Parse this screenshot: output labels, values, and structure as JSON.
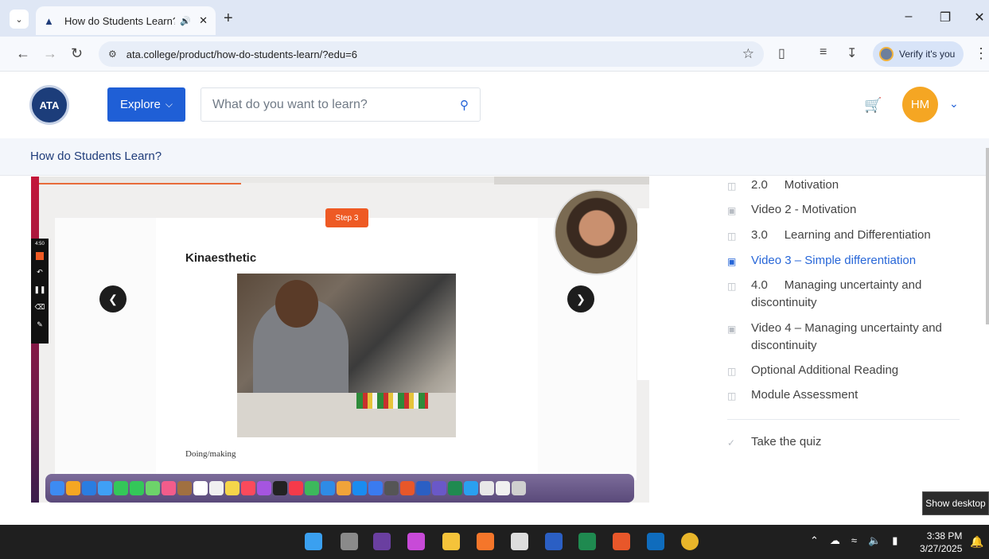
{
  "browser": {
    "tab_title": "How do Students Learn? - A",
    "url": "ata.college/product/how-do-students-learn/?edu=6",
    "verify_label": "Verify it's you"
  },
  "header": {
    "logo_text": "ATA",
    "explore_label": "Explore",
    "search_placeholder": "What do you want to learn?",
    "avatar_initials": "HM"
  },
  "course": {
    "title": "How do Students Learn?"
  },
  "slide": {
    "timer": "4:50",
    "step": "Step 3",
    "heading": "Kinaesthetic",
    "caption": "Doing/making"
  },
  "lessons": [
    {
      "icon": "book-icon",
      "number": "2.0",
      "label": "Motivation",
      "active": false
    },
    {
      "icon": "video-icon",
      "number": "",
      "label": "Video 2 - Motivation",
      "active": false
    },
    {
      "icon": "book-icon",
      "number": "3.0",
      "label": "Learning and Differentiation",
      "active": false
    },
    {
      "icon": "video-icon",
      "number": "",
      "label": "Video 3 – Simple differentiation",
      "active": true
    },
    {
      "icon": "book-icon",
      "number": "4.0",
      "label": "Managing uncertainty and discontinuity",
      "active": false
    },
    {
      "icon": "video-icon",
      "number": "",
      "label": "Video 4 – Managing uncertainty and discontinuity",
      "active": false
    },
    {
      "icon": "book-icon",
      "number": "",
      "label": "Optional Additional Reading",
      "active": false
    },
    {
      "icon": "book-icon",
      "number": "",
      "label": "Module Assessment",
      "active": false
    }
  ],
  "quiz_label": "Take the quiz",
  "tooltip": "Show desktop",
  "taskbar": {
    "time": "3:38 PM",
    "date": "3/27/2025"
  }
}
